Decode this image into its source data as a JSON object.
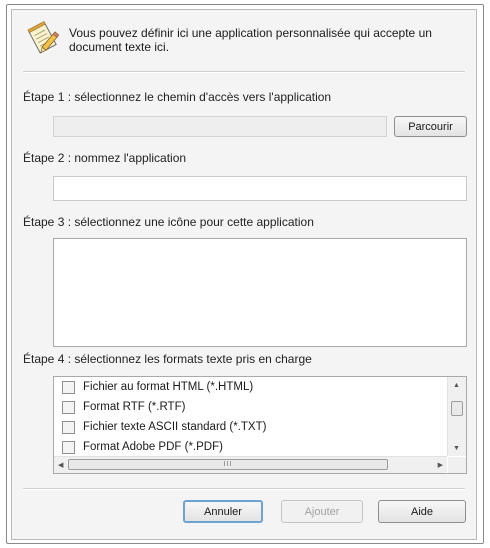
{
  "header": {
    "text": "Vous pouvez définir ici une application personnalisée qui accepte un document texte ici.",
    "icon": "notepad-pencil-icon"
  },
  "step1": {
    "label": "Étape 1 : sélectionnez le chemin d'accès vers l'application",
    "path_value": "",
    "browse_label": "Parcourir"
  },
  "step2": {
    "label": "Étape 2 : nommez l'application",
    "name_value": ""
  },
  "step3": {
    "label": "Étape 3 : sélectionnez une icône pour cette application"
  },
  "step4": {
    "label": "Étape 4 : sélectionnez les formats texte pris en charge",
    "formats": [
      {
        "label": "Fichier au format HTML (*.HTML)",
        "checked": false
      },
      {
        "label": "Format RTF (*.RTF)",
        "checked": false
      },
      {
        "label": "Fichier texte ASCII standard (*.TXT)",
        "checked": false
      },
      {
        "label": "Format Adobe PDF (*.PDF)",
        "checked": false
      }
    ],
    "hscroll_grip": "III"
  },
  "buttons": {
    "cancel": "Annuler",
    "add": "Ajouter",
    "help": "Aide"
  },
  "colors": {
    "default_button_border": "#6ea3cf",
    "dialog_background": "#f4f4f4"
  }
}
